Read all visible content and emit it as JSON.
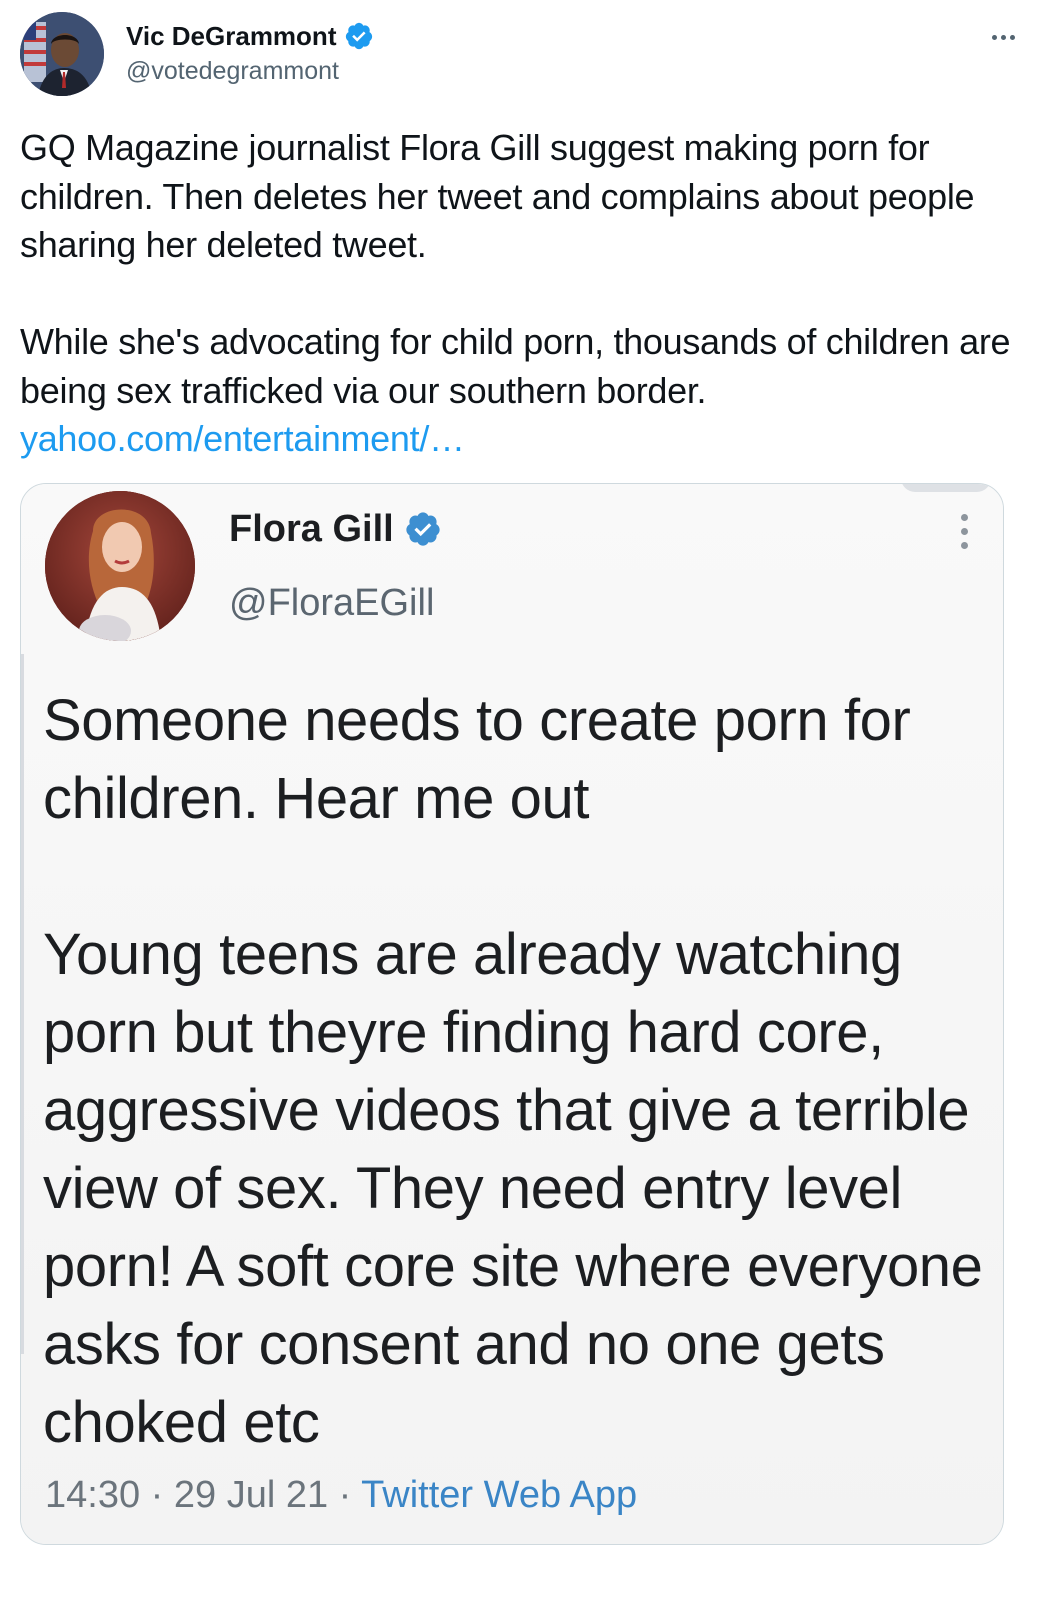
{
  "tweet": {
    "author": {
      "name": "Vic DeGrammont",
      "handle": "@votedegrammont",
      "verified": true
    },
    "text": {
      "paragraph1": "GQ Magazine journalist Flora Gill suggest making porn for children. Then deletes her tweet and complains about people sharing her deleted tweet.",
      "paragraph2": "While she's advocating for child porn, thousands of children are being sex trafficked via our southern border.",
      "link": "yahoo.com/entertainment/…"
    },
    "media": {
      "embedded_tweet": {
        "name": "Flora Gill",
        "handle": "@FloraEGill",
        "verified": true,
        "paragraph1": "Someone needs to create porn for children. Hear me out",
        "paragraph2": "Young teens are already watching porn but theyre finding hard core, aggressive videos that give a terrible view of sex. They need entry level porn! A soft core site where everyone asks for consent and no one gets choked etc",
        "timestamp": "14:30 · 29 Jul 21 · ",
        "source": "Twitter Web App"
      }
    }
  },
  "colors": {
    "link": "#1d9bf0",
    "verified": "#1d9bf0",
    "secondary_text": "#536471",
    "card_border": "#cfd9de"
  },
  "icons": {
    "verified": "verified-badge-icon",
    "more": "more-options-icon"
  }
}
